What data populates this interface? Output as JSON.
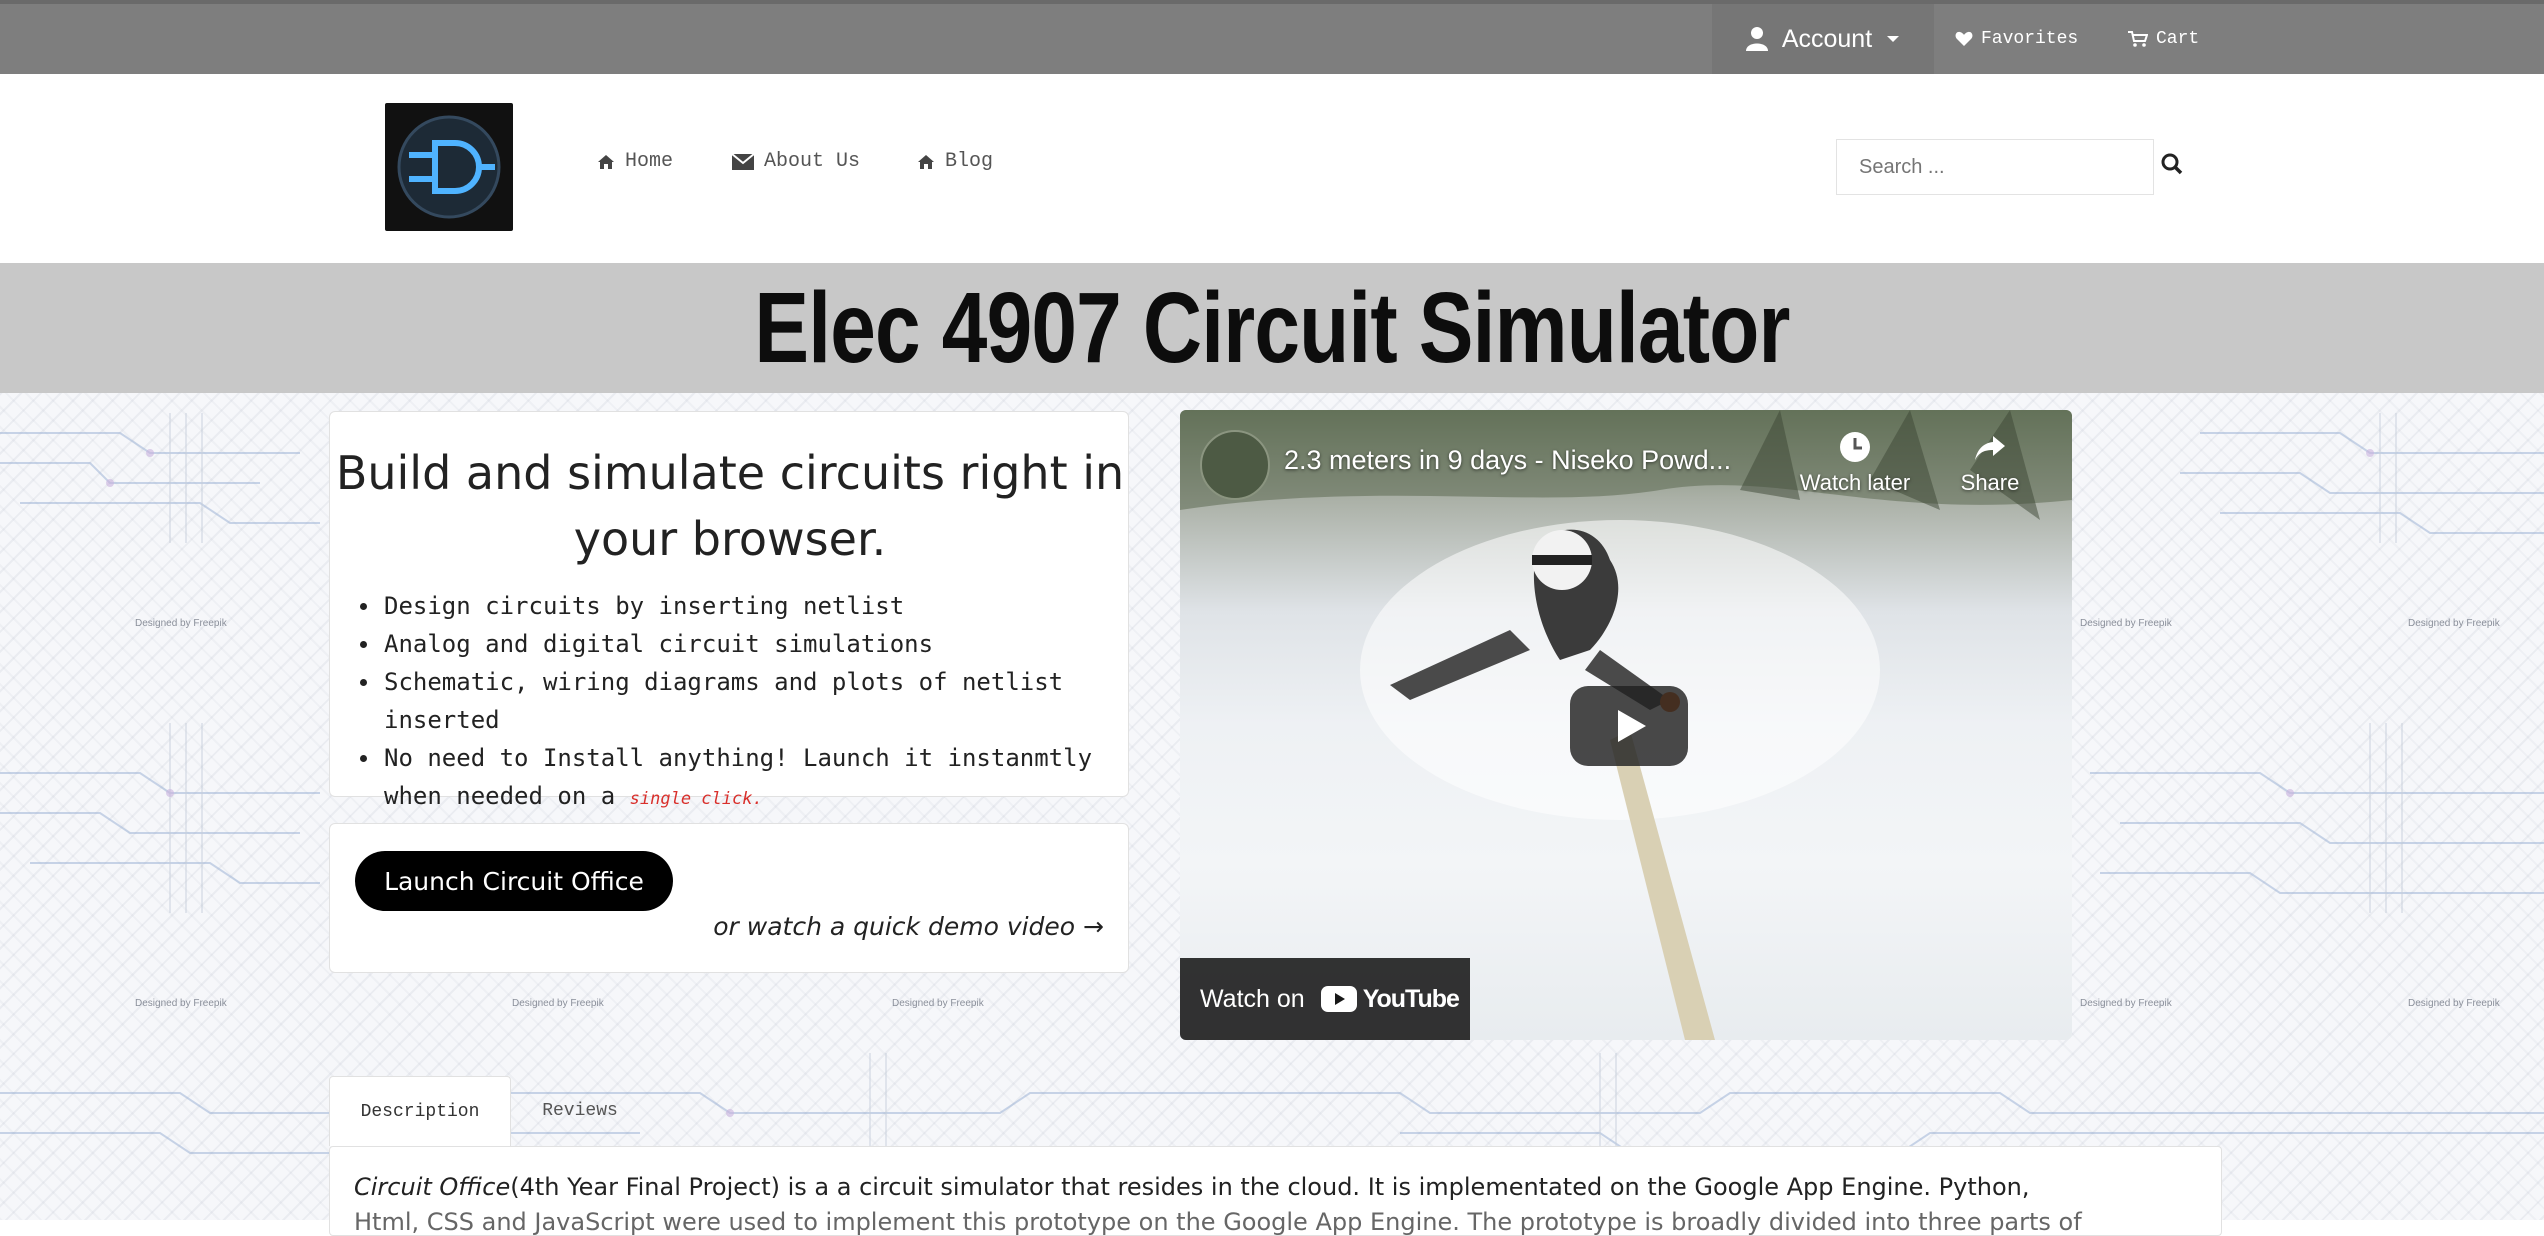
{
  "topbar": {
    "account_label": "Account",
    "favorites_label": "Favorites",
    "cart_label": "Cart"
  },
  "nav": {
    "home": "Home",
    "about": "About Us",
    "blog": "Blog"
  },
  "search": {
    "placeholder": "Search ..."
  },
  "hero": {
    "title": "Elec 4907 Circuit Simulator"
  },
  "intro": {
    "heading": "Build and simulate circuits right in your browser.",
    "features": [
      "Design circuits by inserting netlist",
      "Analog and digital circuit simulations",
      "Schematic, wiring diagrams and plots of netlist inserted",
      "No need to Install anything! Launch it instanmtly when needed on a"
    ],
    "single_click": "single click."
  },
  "launch": {
    "button_label": "Launch Circuit Office",
    "demo_link": "or watch a quick demo video →"
  },
  "video": {
    "title": "2.3 meters in 9 days - Niseko Powd...",
    "watch_later": "Watch later",
    "share": "Share",
    "watch_on": "Watch on",
    "youtube": "YouTube"
  },
  "background": {
    "credit": "Designed by Freepik"
  },
  "tabs": {
    "description": "Description",
    "reviews": "Reviews"
  },
  "description": {
    "product_name": "Circuit Office",
    "text": "(4th Year Final Project) is a a circuit simulator that resides in the cloud. It is implementated on the Google App Engine. Python,",
    "text_partial": "Html, CSS and JavaScript were used to implement this prototype on the Google App Engine. The prototype is broadly divided into three parts of"
  }
}
